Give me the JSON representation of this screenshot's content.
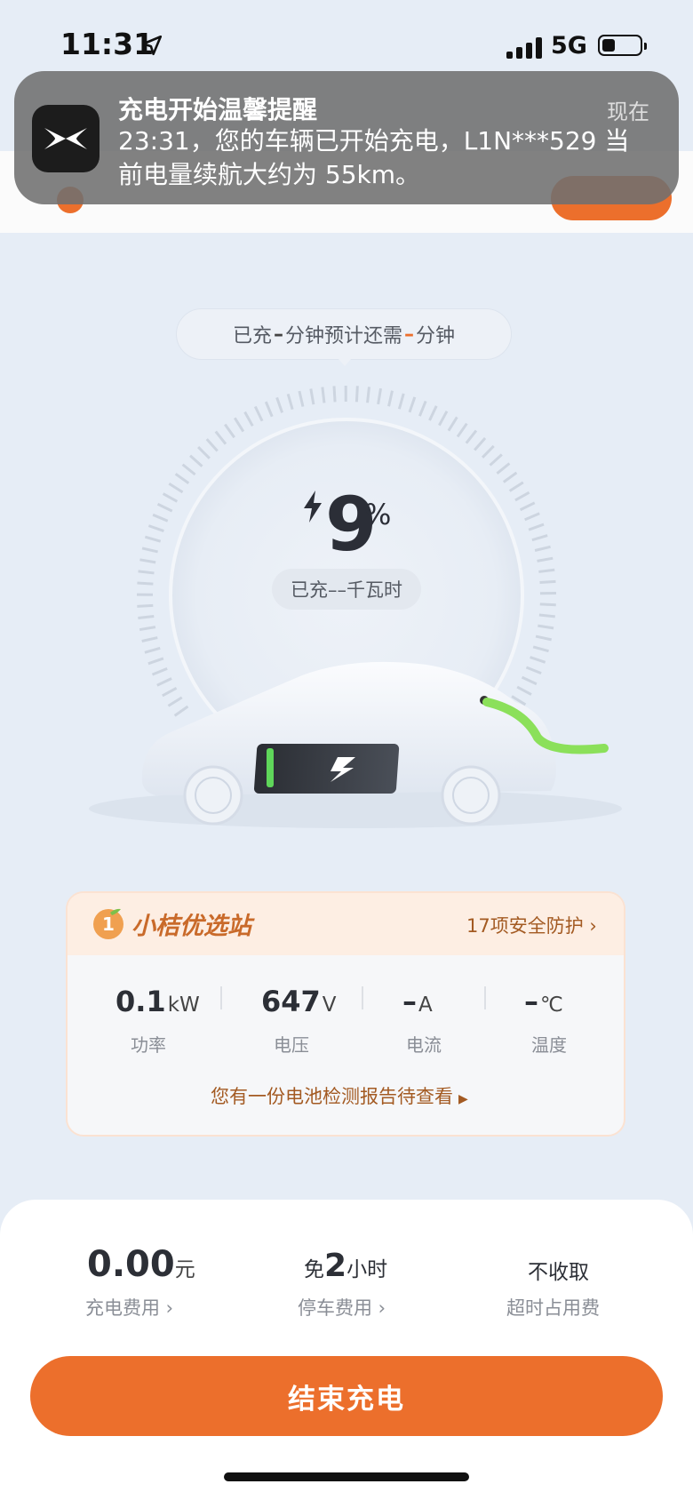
{
  "status_bar": {
    "time": "11:31",
    "network": "5G"
  },
  "notification": {
    "title": "充电开始温馨提醒",
    "time": "现在",
    "body": "23:31，您的车辆已开始充电，L1N***529 当前电量续航大约为 55km。",
    "app_icon": "xpeng-logo-icon"
  },
  "charging": {
    "bubble": {
      "prefix": "已充",
      "charged_minutes": "–",
      "middle": "分钟预计还需",
      "remaining_minutes": "–",
      "suffix": "分钟"
    },
    "percent": "9",
    "percent_sign": "%",
    "energy_text": "已充––千瓦时"
  },
  "station": {
    "name": "小桔优选站",
    "safety_link": "17项安全防护",
    "metrics": [
      {
        "value": "0.1",
        "unit": "kW",
        "label": "功率"
      },
      {
        "value": "647",
        "unit": "V",
        "label": "电压"
      },
      {
        "value": "–",
        "unit": "A",
        "label": "电流"
      },
      {
        "value": "–",
        "unit": "℃",
        "label": "温度"
      }
    ],
    "report_link": "您有一份电池检测报告待查看"
  },
  "fees": {
    "charge": {
      "value": "0.00",
      "unit": "元",
      "label": "充电费用 ›"
    },
    "parking": {
      "prefix": "免",
      "value": "2",
      "unit": "小时",
      "label": "停车费用 ›"
    },
    "overtime": {
      "value": "不收取",
      "label": "超时占用费"
    }
  },
  "end_button": "结束充电",
  "colors": {
    "accent": "#ec6f2c",
    "background": "#e6edf6",
    "cable": "#8be05a"
  }
}
